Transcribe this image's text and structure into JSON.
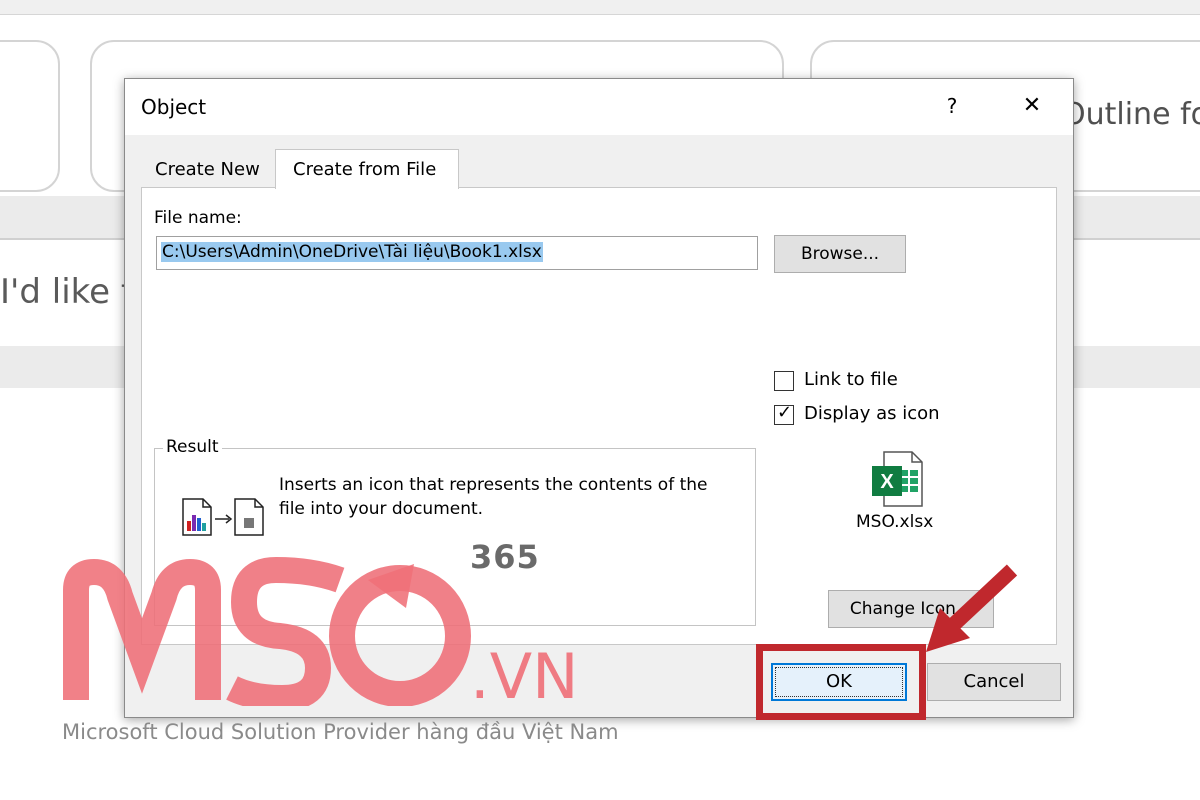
{
  "background": {
    "card_text": "Outline fo",
    "input_text": "I'd like t"
  },
  "dialog": {
    "title": "Object",
    "help_glyph": "?",
    "close_glyph": "✕",
    "tabs": [
      {
        "label": "Create New"
      },
      {
        "label": "Create from File"
      }
    ],
    "file_name_label": "File name:",
    "file_name_value": "C:\\Users\\Admin\\OneDrive\\Tài liệu\\Book1.xlsx",
    "browse_label": "Browse...",
    "link_to_file": {
      "label": "Link to file",
      "checked": false
    },
    "display_as_icon": {
      "label": "Display as icon",
      "checked": true
    },
    "result_legend": "Result",
    "result_text": "Inserts an icon that represents the contents of the file into your document.",
    "icon_caption": "MSO.xlsx",
    "change_icon_label": "Change Icon...",
    "ok_label": "OK",
    "cancel_label": "Cancel"
  },
  "watermark": {
    "brand": "MSO",
    "brand_suffix": ".VN",
    "badge": "365",
    "tagline": "Microsoft Cloud Solution Provider hàng đầu Việt Nam"
  },
  "colors": {
    "accent": "#0078d7",
    "annotation_red": "#c0282d",
    "watermark_pink": "#ef6f78"
  }
}
